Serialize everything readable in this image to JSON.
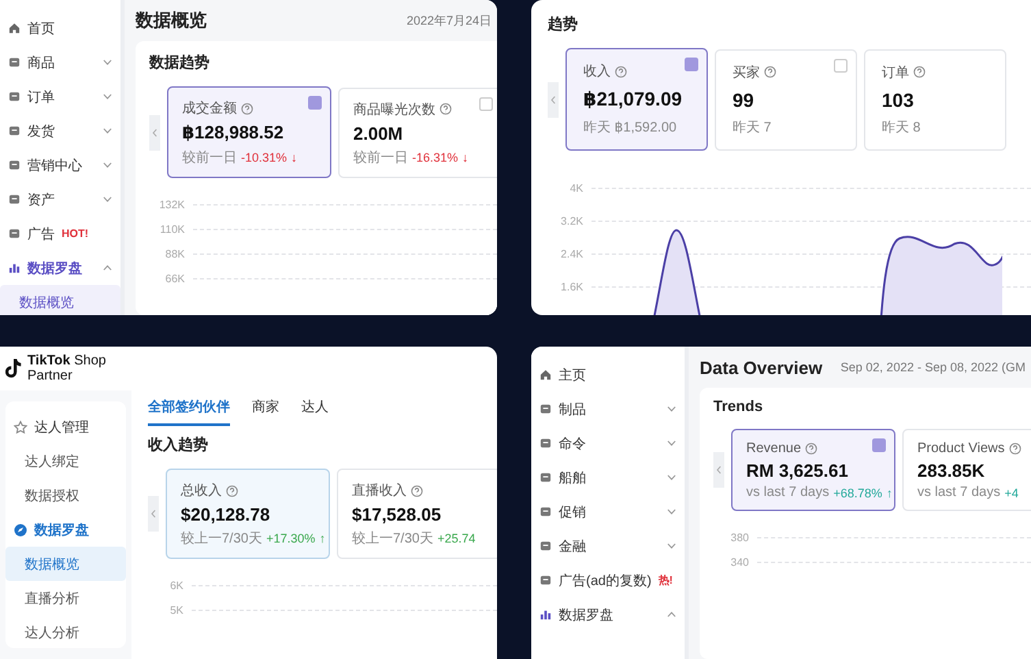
{
  "panels": [
    {
      "kind": "seller",
      "sidebar": [
        {
          "label": "首页",
          "selected": false
        },
        {
          "label": "商品",
          "selected": false,
          "expanded": false
        },
        {
          "label": "订单",
          "selected": false,
          "expanded": false
        },
        {
          "label": "发货",
          "selected": false,
          "expanded": false
        },
        {
          "label": "营销中心",
          "selected": false,
          "expanded": false
        },
        {
          "label": "资产",
          "selected": false,
          "expanded": false
        },
        {
          "label": "广告",
          "badge": "HOT!",
          "selected": false
        },
        {
          "label": "数据罗盘",
          "selected": false,
          "expanded": true,
          "children": [
            {
              "label": "数据概览",
              "selected": true
            }
          ]
        }
      ],
      "title": "数据概览",
      "date": "2022年7月24日",
      "section_title": "数据趋势",
      "cards": [
        {
          "label": "成交金额",
          "value": "฿128,988.52",
          "comparison": "较前一日",
          "change": "-10.31%",
          "arrow": "↓",
          "negative": true,
          "selected": true,
          "checked": true
        },
        {
          "label": "商品曝光次数",
          "value": "2.00M",
          "comparison": "较前一日",
          "change": "-16.31%",
          "arrow": "↓",
          "negative": true,
          "selected": false,
          "checked": false
        }
      ],
      "axis_labels": [
        "132K",
        "110K",
        "88K",
        "66K"
      ]
    },
    {
      "kind": "seller",
      "section_title": "趋势",
      "cards": [
        {
          "label": "收入",
          "value": "฿21,079.09",
          "comparison": "昨天 ฿1,592.00",
          "selected": true,
          "checked": true
        },
        {
          "label": "买家",
          "value": "99",
          "comparison": "昨天 7",
          "selected": false,
          "checked": false
        },
        {
          "label": "订单",
          "value": "103",
          "comparison": "昨天 8",
          "selected": false
        }
      ],
      "axis_labels": [
        "4K",
        "3.2K",
        "2.4K",
        "1.6K"
      ],
      "trend_curve": true
    },
    {
      "kind": "partner",
      "logo_text": "**TikTok** Shop Partner",
      "sidebar": [
        {
          "label": "达人管理",
          "selected": false,
          "children": [
            {
              "label": "达人绑定",
              "selected": false
            },
            {
              "label": "数据授权",
              "selected": false
            }
          ]
        },
        {
          "label": "数据罗盘",
          "selected": false,
          "children": [
            {
              "label": "数据概览",
              "selected": true
            },
            {
              "label": "直播分析",
              "selected": false
            },
            {
              "label": "达人分析",
              "selected": false
            }
          ]
        }
      ],
      "tabs": [
        {
          "label": "全部签约伙伴",
          "selected": true
        },
        {
          "label": "商家",
          "selected": false
        },
        {
          "label": "达人",
          "selected": false
        }
      ],
      "section_title": "收入趋势",
      "cards": [
        {
          "label": "总收入",
          "value": "$20,128.78",
          "comparison": "较上一7/30天",
          "change": "+17.30%",
          "arrow": "↑",
          "negative": false,
          "selected": true
        },
        {
          "label": "直播收入",
          "value": "$17,528.05",
          "comparison": "较上一7/30天",
          "change": "+25.74",
          "negative": false,
          "selected": false
        }
      ],
      "axis_labels": [
        "6K",
        "5K"
      ]
    },
    {
      "kind": "seller",
      "sidebar": [
        {
          "label": "主页",
          "selected": false
        },
        {
          "label": "制品",
          "selected": false,
          "expanded": false
        },
        {
          "label": "命令",
          "selected": false,
          "expanded": false
        },
        {
          "label": "船舶",
          "selected": false,
          "expanded": false
        },
        {
          "label": "促销",
          "selected": false,
          "expanded": false
        },
        {
          "label": "金融",
          "selected": false,
          "expanded": false
        },
        {
          "label": "广告(ad的复数)",
          "badge": "热!",
          "selected": false
        },
        {
          "label": "数据罗盘",
          "selected": false,
          "expanded": true
        }
      ],
      "title": "Data Overview",
      "date": "Sep 02, 2022 - Sep 08, 2022 (GM",
      "section_title": "Trends",
      "cards": [
        {
          "label": "Revenue",
          "value": "RM 3,625.61",
          "comparison": "vs last 7 days",
          "change": "+68.78%",
          "arrow": "↑",
          "negative": false,
          "selected": true,
          "checked": true
        },
        {
          "label": "Product Views",
          "value": "283.85K",
          "comparison": "vs last 7 days",
          "change": "+4",
          "negative": false,
          "selected": false
        }
      ],
      "axis_labels": [
        "380",
        "340"
      ]
    }
  ]
}
